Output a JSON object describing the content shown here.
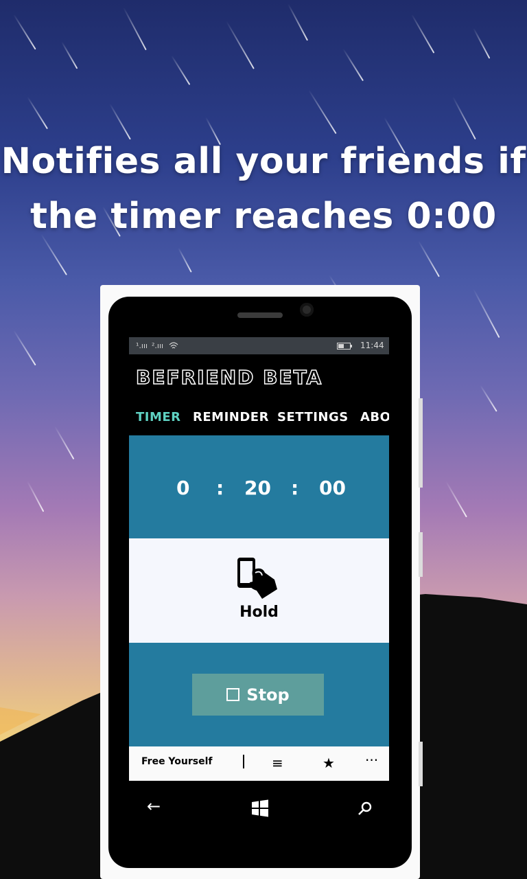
{
  "headline": {
    "line1": "Notifies all your friends if",
    "line2": "the timer reaches 0:00"
  },
  "statusbar": {
    "sig1": "¹.ııı",
    "sig2": "².ııı",
    "time": "11:44"
  },
  "app": {
    "title": "BEFRIEND BETA",
    "tabs": [
      "TIMER",
      "REMINDER",
      "SETTINGS",
      "ABO"
    ],
    "active_tab": "TIMER",
    "timer": {
      "hours": "0",
      "sep1": ":",
      "minutes": "20",
      "sep2": ":",
      "seconds": "00"
    },
    "hold_label": "Hold",
    "stop_label": "Stop",
    "appbar": {
      "text": "Free Yourself",
      "list_icon": "≡",
      "star_icon": "★",
      "more_icon": "···"
    }
  },
  "nav": {
    "back": "←",
    "search": "⚲"
  },
  "colors": {
    "accent": "#5fd1c2",
    "panel": "#247b9f",
    "button": "#5e9e9c"
  }
}
